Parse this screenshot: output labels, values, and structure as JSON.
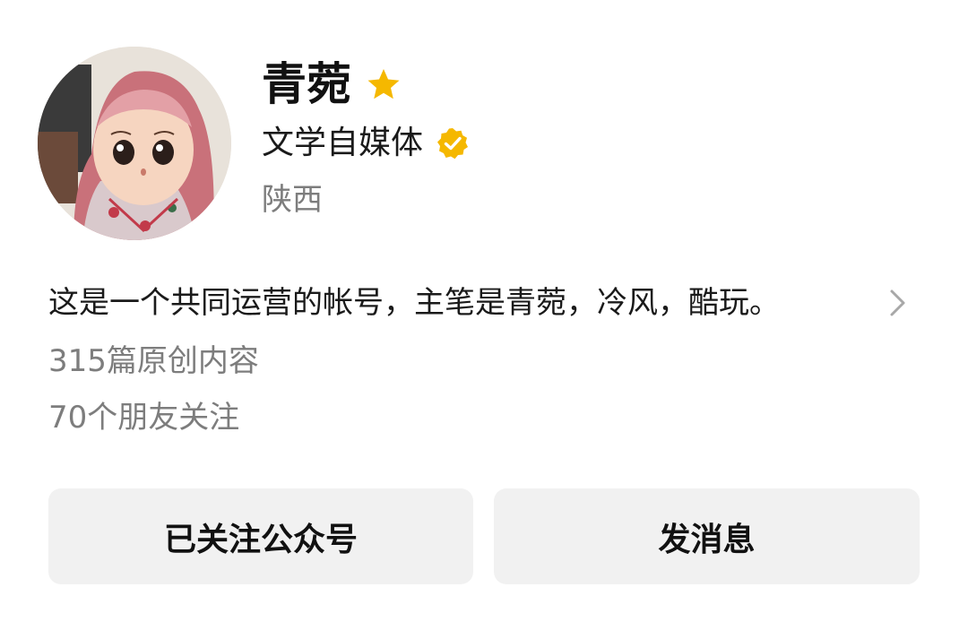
{
  "profile": {
    "name": "青菀",
    "certification": "文学自媒体",
    "location": "陕西",
    "description": "这是一个共同运营的帐号，主笔是青菀，冷风，酷玩。",
    "original_count": "315篇原创内容",
    "friends_following": "70个朋友关注"
  },
  "icons": {
    "star": "star-icon",
    "verified": "verified-badge-icon",
    "chevron": "chevron-right-icon",
    "avatar": "doll-avatar"
  },
  "colors": {
    "star": "#F5B800",
    "verified": "#F5B800",
    "secondary_text": "#7D7D7D",
    "button_bg": "#F1F1F1"
  },
  "actions": {
    "follow_label": "已关注公众号",
    "message_label": "发消息"
  }
}
